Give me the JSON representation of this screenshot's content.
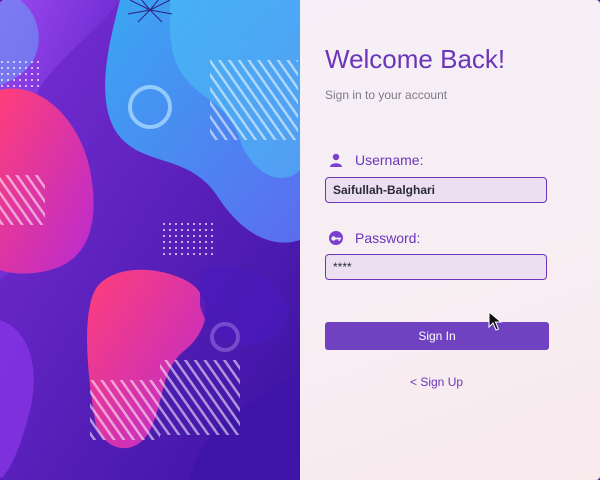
{
  "header": {
    "title": "Welcome Back!",
    "subtitle": "Sign in to your account"
  },
  "form": {
    "username_label": "Username:",
    "username_value": "Saifullah-Balghari",
    "password_label": "Password:",
    "password_value": "****",
    "sign_in_label": "Sign In",
    "sign_up_label": "< Sign Up"
  },
  "icons": {
    "username": "user-icon",
    "password": "key-icon"
  },
  "colors": {
    "accent": "#6a35b8",
    "button": "#7041c0",
    "field_bg": "#ecdff1",
    "panel_bg": "#f7eef3"
  }
}
